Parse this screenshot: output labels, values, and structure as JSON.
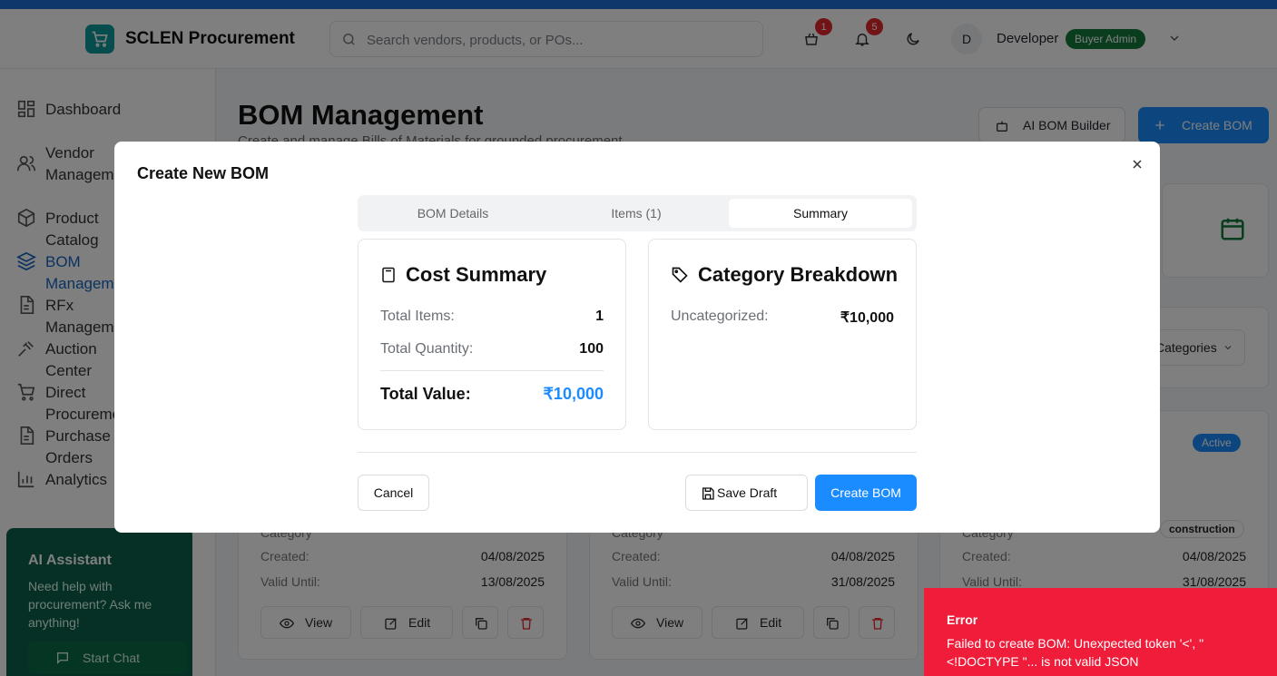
{
  "app": {
    "title": "SCLEN Procurement"
  },
  "header": {
    "search_placeholder": "Search vendors, products, or POs...",
    "cart_badge": "1",
    "notifications_badge": "5",
    "user_initial": "D",
    "user_name": "Developer",
    "user_role": "Buyer Admin"
  },
  "sidebar": {
    "items": [
      {
        "label": "Dashboard",
        "icon": "dashboard-icon"
      },
      {
        "label": "Vendor\nManagement",
        "icon": "users-icon"
      },
      {
        "label": "Product Catalog",
        "icon": "box-icon"
      },
      {
        "label": "BOM Management",
        "icon": "layers-icon",
        "active": true
      },
      {
        "label": "RFx Management",
        "icon": "file-icon"
      },
      {
        "label": "Auction Center",
        "icon": "gavel-icon"
      },
      {
        "label": "Direct Procurement",
        "icon": "cart-icon"
      },
      {
        "label": "Purchase Orders",
        "icon": "file-icon"
      },
      {
        "label": "Analytics",
        "icon": "chart-icon"
      }
    ],
    "ai_assistant": {
      "title": "AI Assistant",
      "description": "Need help with procurement? Ask me anything!",
      "button": "Start Chat"
    }
  },
  "page": {
    "title": "BOM Management",
    "subtitle": "Create and manage Bills of Materials for grounded procurement",
    "ai_builder_button": "AI BOM Builder",
    "create_button": "Create BOM",
    "filter_select": "Categories",
    "status_badge": "Active",
    "category_tag": "construction"
  },
  "cards": [
    {
      "category_label": "Category",
      "created_label": "Created:",
      "created": "04/08/2025",
      "valid_label": "Valid Until:",
      "valid": "13/08/2025",
      "view": "View",
      "edit": "Edit"
    },
    {
      "category_label": "Category",
      "created_label": "Created:",
      "created": "04/08/2025",
      "valid_label": "Valid Until:",
      "valid": "31/08/2025",
      "view": "View",
      "edit": "Edit"
    },
    {
      "category_label": "Category",
      "created_label": "Created:",
      "created": "04/08/2025",
      "valid_label": "Valid Until:",
      "valid": "31/08/2025"
    }
  ],
  "modal": {
    "title": "Create New BOM",
    "tabs": [
      {
        "label": "BOM Details",
        "active": false
      },
      {
        "label": "Items (1)",
        "active": false
      },
      {
        "label": "Summary",
        "active": true
      }
    ],
    "cost_summary": {
      "title": "Cost Summary",
      "total_items_label": "Total Items:",
      "total_items": "1",
      "total_quantity_label": "Total Quantity:",
      "total_quantity": "100",
      "total_value_label": "Total Value:",
      "total_value": "₹10,000"
    },
    "category_breakdown": {
      "title": "Category Breakdown",
      "rows": [
        {
          "label": "Uncategorized:",
          "value": "₹10,000"
        }
      ]
    },
    "cancel_button": "Cancel",
    "save_draft_button": "Save Draft",
    "create_button": "Create BOM"
  },
  "toast": {
    "title": "Error",
    "message": "Failed to create BOM: Unexpected token '<', \"<!DOCTYPE \"... is not valid JSON"
  },
  "colors": {
    "primary": "#1a8cff",
    "error": "#ef1c3a",
    "role_badge": "#127a3a"
  }
}
